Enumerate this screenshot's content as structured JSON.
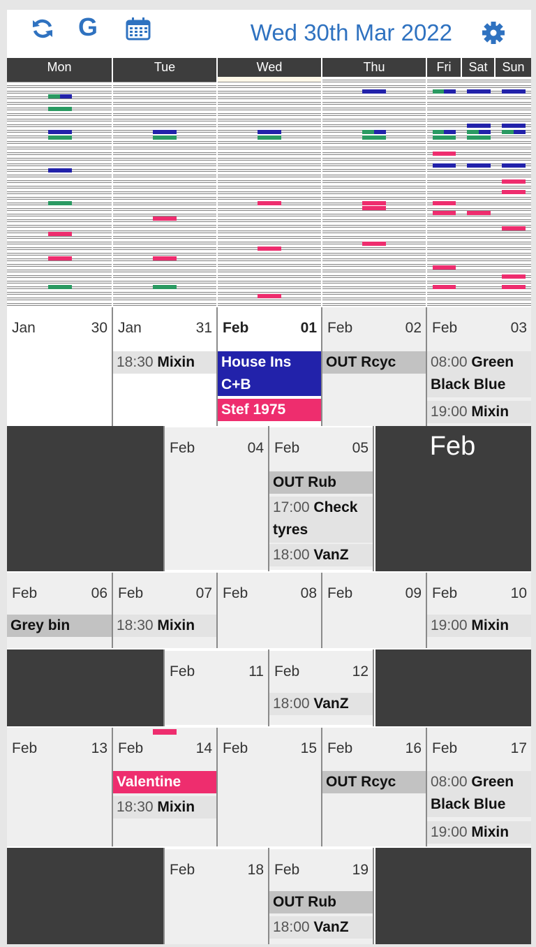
{
  "header": {
    "refresh_icon": "refresh-icon",
    "google_label": "G",
    "calendar_icon": "calendar-icon",
    "settings_icon": "gear-icon",
    "title": "Wed 30th Mar 2022"
  },
  "day_headers": [
    "Mon",
    "Tue",
    "Wed",
    "Thu",
    "Fri",
    "Sat",
    "Sun"
  ],
  "colors": {
    "green": "#2a9a62",
    "blue": "#2222aa",
    "pink": "#ee2d6e",
    "dark": "#3d3d3d",
    "accent": "#2f72c0"
  },
  "weeks": [
    {
      "days": [
        {
          "mon": "Jan",
          "day": "30"
        },
        {
          "mon": "Jan",
          "day": "31",
          "events": [
            {
              "time": "18:30",
              "name": "Mixin"
            }
          ]
        },
        {
          "mon": "Feb",
          "day": "01",
          "events": [
            {
              "name": "House Ins C+B"
            },
            {
              "name": "Stef 1975"
            }
          ]
        },
        {
          "mon": "Feb",
          "day": "02",
          "events": [
            {
              "name": "OUT Rcyc"
            }
          ]
        },
        {
          "mon": "Feb",
          "day": "03",
          "events": [
            {
              "time": "08:00",
              "name": "Green Black Blue"
            },
            {
              "time": "19:00",
              "name": "Mixin"
            }
          ]
        }
      ]
    },
    {
      "days": [
        {
          "mon": "Feb",
          "day": "04"
        },
        {
          "mon": "Feb",
          "day": "05",
          "events": [
            {
              "name": "OUT Rub"
            },
            {
              "time": "17:00",
              "name": "Check tyres"
            },
            {
              "time": "18:00",
              "name": "VanZ"
            }
          ]
        }
      ],
      "side_month": "Feb"
    },
    {
      "days": [
        {
          "mon": "Feb",
          "day": "06",
          "events": [
            {
              "name": "Grey bin"
            }
          ]
        },
        {
          "mon": "Feb",
          "day": "07",
          "events": [
            {
              "time": "18:30",
              "name": "Mixin"
            }
          ]
        },
        {
          "mon": "Feb",
          "day": "08"
        },
        {
          "mon": "Feb",
          "day": "09"
        },
        {
          "mon": "Feb",
          "day": "10",
          "events": [
            {
              "time": "19:00",
              "name": "Mixin"
            }
          ]
        }
      ]
    },
    {
      "days": [
        {
          "mon": "Feb",
          "day": "11"
        },
        {
          "mon": "Feb",
          "day": "12",
          "events": [
            {
              "time": "18:00",
              "name": "VanZ"
            }
          ]
        }
      ]
    },
    {
      "days": [
        {
          "mon": "Feb",
          "day": "13"
        },
        {
          "mon": "Feb",
          "day": "14",
          "events": [
            {
              "name": "Valentine"
            },
            {
              "time": "18:30",
              "name": "Mixin"
            }
          ]
        },
        {
          "mon": "Feb",
          "day": "15"
        },
        {
          "mon": "Feb",
          "day": "16",
          "events": [
            {
              "name": "OUT Rcyc"
            }
          ]
        },
        {
          "mon": "Feb",
          "day": "17",
          "events": [
            {
              "time": "08:00",
              "name": "Green Black Blue"
            },
            {
              "time": "19:00",
              "name": "Mixin"
            }
          ]
        }
      ]
    },
    {
      "days": [
        {
          "mon": "Feb",
          "day": "18"
        },
        {
          "mon": "Feb",
          "day": "19",
          "events": [
            {
              "name": "OUT Rub"
            },
            {
              "time": "18:00",
              "name": "VanZ"
            }
          ]
        }
      ]
    }
  ]
}
